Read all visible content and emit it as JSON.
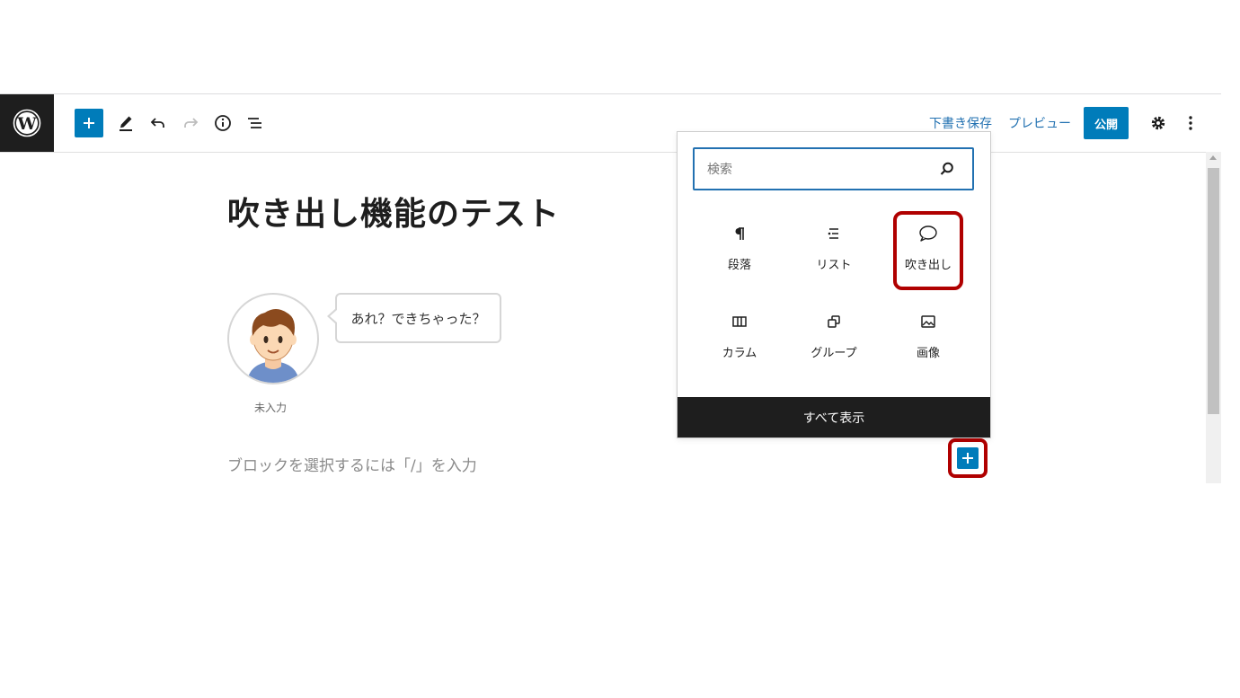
{
  "toolbar": {
    "save_draft": "下書き保存",
    "preview": "プレビュー",
    "publish": "公開"
  },
  "post": {
    "title": "吹き出し機能のテスト",
    "balloon": {
      "text": "あれ？できちゃった？",
      "avatar_name": "未入力"
    },
    "block_placeholder": "ブロックを選択するには「/」を入力"
  },
  "inserter": {
    "search_placeholder": "検索",
    "blocks": [
      {
        "label": "段落",
        "icon": "paragraph-icon"
      },
      {
        "label": "リスト",
        "icon": "list-icon"
      },
      {
        "label": "吹き出し",
        "icon": "speech-bubble-icon"
      },
      {
        "label": "カラム",
        "icon": "columns-icon"
      },
      {
        "label": "グループ",
        "icon": "group-icon"
      },
      {
        "label": "画像",
        "icon": "image-icon"
      }
    ],
    "show_all": "すべて表示"
  },
  "colors": {
    "accent": "#007cba",
    "link": "#2271b1",
    "highlight": "#b00000",
    "dark": "#1e1e1e"
  }
}
